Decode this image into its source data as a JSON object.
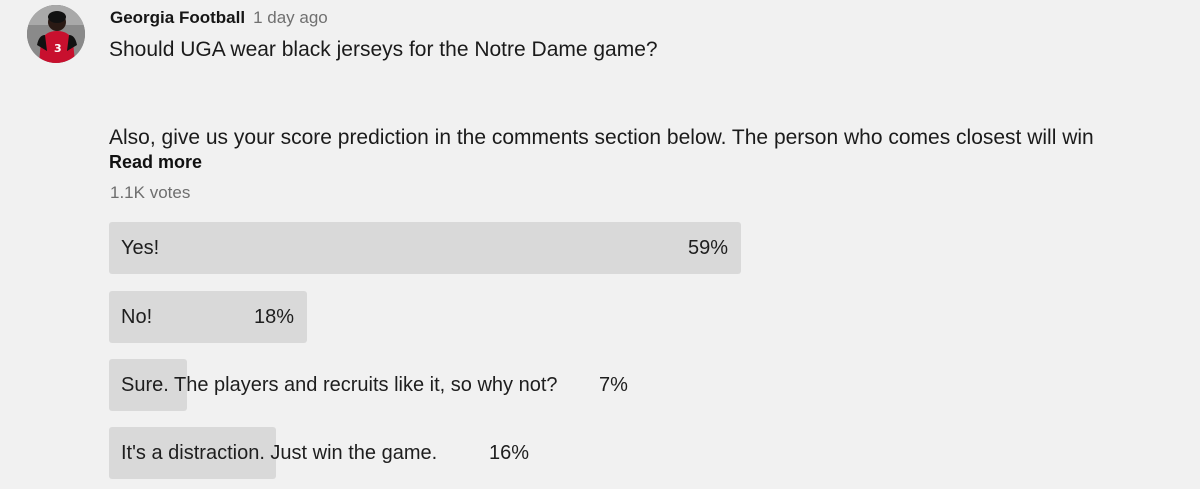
{
  "post": {
    "author": "Georgia Football",
    "timestamp": "1 day ago",
    "question": "Should UGA wear black jerseys for the Notre Dame game?",
    "body": "Also, give us your score prediction in the comments section below. The person who comes closest will win",
    "read_more": "Read more",
    "votes": "1.1K votes",
    "avatar": {
      "icon": "player-avatar",
      "jersey_number": "3"
    }
  },
  "poll": {
    "options": [
      {
        "label": "Yes!",
        "percent_text": "59%",
        "percent": 59
      },
      {
        "label": "No!",
        "percent_text": "18%",
        "percent": 18
      },
      {
        "label": "Sure. The players and recruits like it, so why not?",
        "percent_text": "7%",
        "percent": 7
      },
      {
        "label": "It's a distraction. Just win the game.",
        "percent_text": "16%",
        "percent": 16
      }
    ]
  },
  "colors": {
    "background": "#f1f1f1",
    "bar_fill": "#d9d9d9",
    "text": "#1b1b1b",
    "muted_text": "#6e6e6e"
  }
}
